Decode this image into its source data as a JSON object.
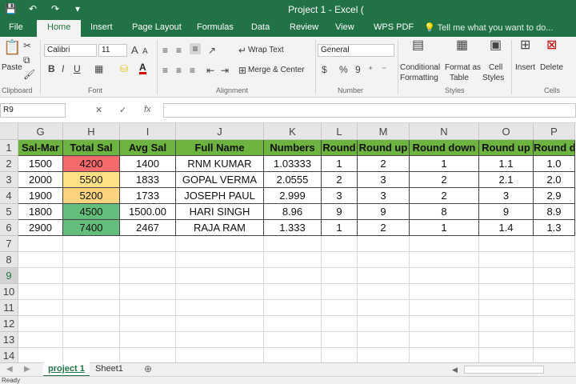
{
  "title": "Project 1 - Excel (",
  "qat": {
    "save": "💾",
    "undo": "↶",
    "redo": "↷",
    "more": "▾"
  },
  "tabs": [
    "File",
    "Home",
    "Insert",
    "Page Layout",
    "Formulas",
    "Data",
    "Review",
    "View",
    "WPS PDF"
  ],
  "active_tab": "Home",
  "tell_me": "Tell me what you want to do...",
  "ribbon": {
    "clipboard": {
      "paste": "Paste",
      "label": "Clipboard"
    },
    "font": {
      "name": "Calibri",
      "size": "11",
      "bold": "B",
      "italic": "I",
      "underline": "U",
      "label": "Font",
      "grow": "A",
      "shrink": "A",
      "font_color_letter": "A"
    },
    "alignment": {
      "wrap_text": "Wrap Text",
      "merge_center": "Merge & Center",
      "label": "Alignment"
    },
    "number": {
      "format": "General",
      "currency": "$",
      "percent": "%",
      "comma": "9",
      "label": "Number"
    },
    "styles": {
      "conditional": "Conditional",
      "formatting": "Formatting",
      "format_as": "Format as",
      "table": "Table",
      "cell": "Cell",
      "cell_styles": "Styles",
      "label": "Styles"
    },
    "cells": {
      "insert": "Insert",
      "delete": "Delete",
      "label": "Cells"
    }
  },
  "namebox": "R9",
  "fx": "fx",
  "columns": [
    "G",
    "H",
    "I",
    "J",
    "K",
    "L",
    "M",
    "N",
    "O",
    "P"
  ],
  "rows": [
    "1",
    "2",
    "3",
    "4",
    "5",
    "6",
    "7",
    "8",
    "9",
    "10",
    "11",
    "12",
    "13",
    "14"
  ],
  "selected_row": "9",
  "headers": [
    "Sal-Mar",
    "Total Sal",
    "Avg Sal",
    "Full Name",
    "Numbers",
    "Round",
    "Round up",
    "Round down",
    "Round up",
    "Round d"
  ],
  "data": [
    [
      "1500",
      "4200",
      "1400",
      "RNM  KUMAR",
      "1.03333",
      "1",
      "2",
      "1",
      "1.1",
      "1.0"
    ],
    [
      "2000",
      "5500",
      "1833",
      "GOPAL  VERMA",
      "2.0555",
      "2",
      "3",
      "2",
      "2.1",
      "2.0"
    ],
    [
      "1900",
      "5200",
      "1733",
      "JOSEPH  PAUL",
      "2.999",
      "3",
      "3",
      "2",
      "3",
      "2.9"
    ],
    [
      "1800",
      "4500",
      "1500.00",
      "HARI  SINGH",
      "8.96",
      "9",
      "9",
      "8",
      "9",
      "8.9"
    ],
    [
      "2900",
      "7400",
      "2467",
      "RAJA  RAM",
      "1.333",
      "1",
      "2",
      "1",
      "1.4",
      "1.3"
    ]
  ],
  "total_sal_colors": [
    "#f8696b",
    "#ffe083",
    "#fbd37e",
    "#63be7b",
    "#63be7b"
  ],
  "header_color": "#6db33f",
  "sheets": [
    "project 1",
    "Sheet1"
  ],
  "active_sheet": "project 1",
  "status": "Ready"
}
